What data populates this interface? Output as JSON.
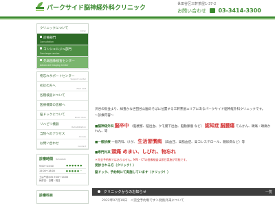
{
  "header": {
    "title": "パークサイド脳神経外科クリニック",
    "address": "世田谷区三軒茶屋1-37-2",
    "contact_label": "お問い合わせ",
    "phone": "03-3414-3300"
  },
  "sidebar": {
    "items": [
      {
        "label": "クリニックについて",
        "en": "Clinic"
      },
      {
        "label": "診療部門",
        "en": "Consultation"
      },
      {
        "label": "コンシェルジュ部門",
        "en": "Concierge service"
      },
      {
        "label": "先端画像検査センター",
        "en": "Advanced Imaging Center"
      },
      {
        "label": "物忘れサポートセンター",
        "en": "Support center"
      },
      {
        "label": "初診の方へ",
        "en": "Fisrt visit"
      },
      {
        "label": "各種検査について",
        "en": ""
      },
      {
        "label": "医療機関の皆様へ",
        "en": ""
      },
      {
        "label": "脳ドックについて",
        "en": "Brain dock"
      },
      {
        "label": "リハビリ機器",
        "en": "Rehabilitation"
      },
      {
        "label": "当院へのアクセス",
        "en": "Access"
      },
      {
        "label": "お問い合わせ",
        "en": "Contact"
      }
    ],
    "schedule": {
      "title": "診療時間",
      "en": "Schedule",
      "rows": [
        {
          "time": "9:00～13:00",
          "marks": "● ● ● ● ● ●"
        },
        {
          "time": "15:00～18:00",
          "marks": "● ● ● ● ● －"
        }
      ],
      "note1": "土は午前のみ 9:00～14:00",
      "note2": "休診日：日曜・祝日"
    },
    "schedule2_title": "診療科目"
  },
  "main": {
    "text1": "渋谷の街並より、緑豊かな世田谷公園のそばに位置する三軒茶屋エリアにあるパークサイド脳神経外科クリニックです。",
    "head": "〜診療内容〜",
    "dept1_label": "■脳神経外科",
    "dept1_big": "脳卒中",
    "dept1_rest": "（脳梗塞、脳出血、クモ膜下出血、脳動脈瘤 など）",
    "dept1_big2": "認知症",
    "dept1_big3": "脳腫瘍",
    "dept1_rest2": "てんかん、頭痛・頭痛かれん、等",
    "dept2_label": "■一般診療",
    "dept2_text": "一般内科、けが、",
    "dept2_big": "生活習慣病",
    "dept2_rest": "（高血圧、高脂血症、高コレステロール、糖尿病など）等",
    "dept3_label": "■専門外来",
    "dept3_big": "頭痛 めまい、しびれ、物忘れ",
    "note": "＊完全予約制ではありません。MRI・CTの画像検査は即日実施が可能です。",
    "link1": "受診される方（クリック！）",
    "link2": "脳ドック、予約制にて実施しています（クリック！）"
  },
  "news": {
    "title": "クリニックからのお知らせ",
    "more": "一覧",
    "item": "2022年07月19日　＜完全予約制です＞発熱外来について"
  }
}
